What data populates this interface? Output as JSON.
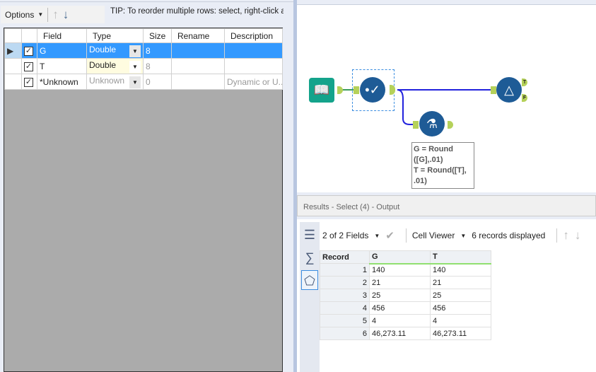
{
  "toolbar": {
    "options_label": "Options",
    "up_icon": "arrow-up",
    "down_icon": "arrow-down"
  },
  "tip": "TIP: To reorder multiple rows: select, right-click and drag",
  "select_grid": {
    "headers": [
      "Field",
      "Type",
      "Size",
      "Rename",
      "Description"
    ],
    "rows": [
      {
        "field": "G",
        "type": "Double",
        "size": "8",
        "rename": "",
        "description": "",
        "checked": true
      },
      {
        "field": "T",
        "type": "Double",
        "size": "8",
        "rename": "",
        "description": "",
        "checked": true
      },
      {
        "field": "*Unknown",
        "type": "Unknown",
        "size": "0",
        "rename": "",
        "description": "Dynamic or U...",
        "checked": true
      }
    ]
  },
  "workflow": {
    "annotation_lines": [
      "G = Round",
      "([G],.01)",
      "T = Round([T],",
      ".01)"
    ],
    "filter_anchors": [
      "T",
      "F"
    ]
  },
  "results": {
    "title": "Results - Select (4) - Output",
    "fields_label": "2 of 2 Fields",
    "viewer_label": "Cell Viewer",
    "records_label": "6 records displayed",
    "headers": [
      "Record",
      "G",
      "T"
    ],
    "rows": [
      [
        "1",
        "140",
        "140"
      ],
      [
        "2",
        "21",
        "21"
      ],
      [
        "3",
        "25",
        "25"
      ],
      [
        "4",
        "456",
        "456"
      ],
      [
        "5",
        "4",
        "4"
      ],
      [
        "6",
        "46,273.11",
        "46,273.11"
      ]
    ]
  },
  "colors": {
    "accent": "#3399ff",
    "tool_blue": "#1e5b96",
    "connection": "#2222dd",
    "input_green": "#14a38b"
  }
}
